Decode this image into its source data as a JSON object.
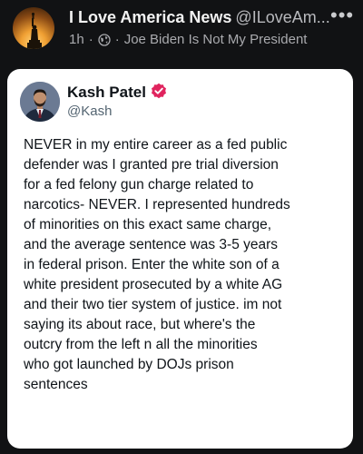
{
  "post": {
    "page_name": "I Love America News",
    "page_handle": "@ILoveAm...",
    "more_label": "•••",
    "age": "1h",
    "separator": "·",
    "group_name": "Joe Biden Is Not My President"
  },
  "tweet": {
    "author_name": "Kash Patel",
    "author_handle": "@Kash",
    "lines": [
      "NEVER in my entire career as a fed public",
      "defender was I granted pre trial diversion",
      "for a fed felony gun charge related to",
      "narcotics- NEVER. I represented hundreds",
      "of minorities on this exact same charge,",
      "and the average sentence was 3-5 years",
      "in federal prison. Enter the white son of a",
      "white president prosecuted by a white AG",
      "and their two tier system of justice. im not",
      "saying its about race, but where's the",
      "outcry from the left n all the minorities",
      "who got launched by DOJs prison",
      "sentences"
    ]
  },
  "colors": {
    "background": "#111214",
    "card": "#ffffff",
    "verified_badge": "#e0245e"
  },
  "icons": {
    "page_avatar": "statue-of-liberty-sunset",
    "globe": "globe-icon",
    "more": "more-options-icon",
    "verified": "verified-badge-icon"
  }
}
